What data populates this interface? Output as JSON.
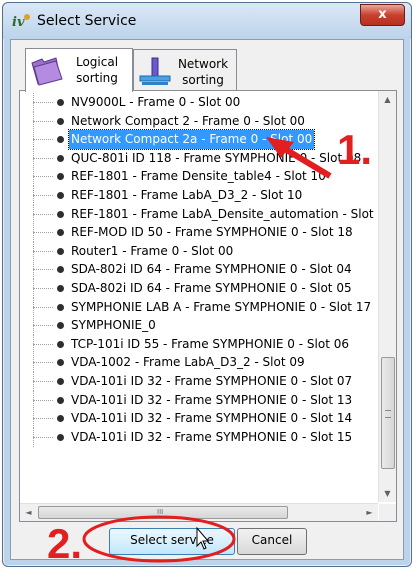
{
  "window": {
    "title": "Select Service",
    "close_label": "x"
  },
  "tabs": [
    {
      "line1": "Logical",
      "line2": "sorting"
    },
    {
      "line1": "Network",
      "line2": "sorting"
    }
  ],
  "services": [
    "NV9000L - Frame 0 - Slot 00",
    "Network Compact 2 - Frame 0 - Slot 00",
    "Network Compact 2a - Frame 0 - Slot 00",
    "QUC-801i ID 118 - Frame SYMPHONIE 0 - Slot 08",
    "REF-1801 - Frame Densite_table4 - Slot 10",
    "REF-1801 - Frame LabA_D3_2 - Slot 10",
    "REF-1801 - Frame LabA_Densite_automation - Slot",
    "REF-MOD ID 50 - Frame SYMPHONIE 0 - Slot 18",
    "Router1 - Frame 0 - Slot 00",
    "SDA-802i ID 64 - Frame SYMPHONIE 0 - Slot 04",
    "SDA-802i ID 64 - Frame SYMPHONIE 0 - Slot 05",
    "SYMPHONIE LAB A - Frame SYMPHONIE 0 - Slot 17",
    "SYMPHONIE_0",
    "TCP-101i ID 55 - Frame SYMPHONIE 0 - Slot 06",
    "VDA-1002 - Frame LabA_D3_2 - Slot 09",
    "VDA-101i ID 32 - Frame SYMPHONIE 0 - Slot 07",
    "VDA-101i ID 32 - Frame SYMPHONIE 0 - Slot 13",
    "VDA-101i ID 32 - Frame SYMPHONIE 0 - Slot 14",
    "VDA-101i ID 32 - Frame SYMPHONIE 0 - Slot 15"
  ],
  "selected_index": 2,
  "buttons": {
    "select": "Select service",
    "cancel": "Cancel"
  },
  "annotations": {
    "step1": "1.",
    "step2": "2."
  },
  "colors": {
    "selection": "#3399ff",
    "annotation": "#e21e1e"
  },
  "scrollbar": {
    "hgrip": "III"
  }
}
